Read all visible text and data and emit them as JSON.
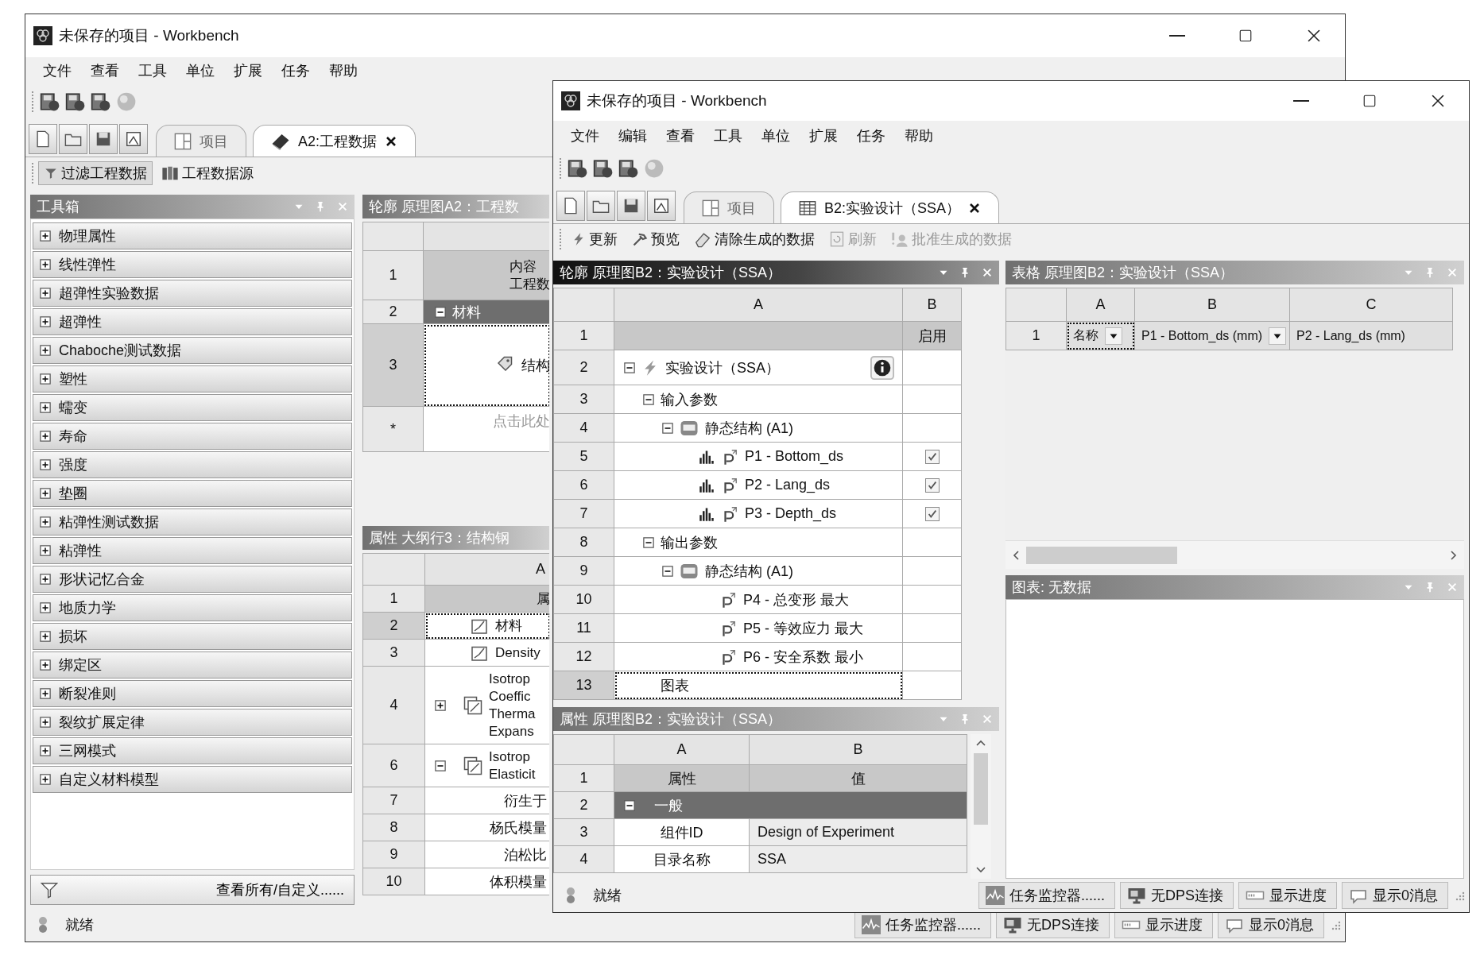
{
  "back_window": {
    "title": "未保存的项目 - Workbench",
    "menu": [
      "文件",
      "查看",
      "工具",
      "单位",
      "扩展",
      "任务",
      "帮助"
    ],
    "tabs": [
      {
        "label": "项目",
        "kind": "project",
        "selected": false,
        "closable": false
      },
      {
        "label": "A2:工程数据",
        "kind": "book",
        "selected": true,
        "closable": true
      }
    ],
    "filter_bar": [
      {
        "label": "过滤工程数据",
        "kind": "filter",
        "pressed": true
      },
      {
        "label": "工程数据源",
        "kind": "source",
        "pressed": false
      }
    ],
    "toolbox": {
      "title": "工具箱",
      "active": false,
      "items": [
        {
          "label": "物理属性",
          "expanded": false
        },
        {
          "label": "线性弹性",
          "expanded": false
        },
        {
          "label": "超弹性实验数据",
          "expanded": false
        },
        {
          "label": "超弹性",
          "expanded": false
        },
        {
          "label": "Chaboche测试数据",
          "expanded": false
        },
        {
          "label": "塑性",
          "expanded": false
        },
        {
          "label": "蠕变",
          "expanded": false
        },
        {
          "label": "寿命",
          "expanded": false
        },
        {
          "label": "强度",
          "expanded": false
        },
        {
          "label": "垫圈",
          "expanded": false
        },
        {
          "label": "粘弹性测试数据",
          "expanded": false
        },
        {
          "label": "粘弹性",
          "expanded": false
        },
        {
          "label": "形状记忆合金",
          "expanded": false
        },
        {
          "label": "地质力学",
          "expanded": false
        },
        {
          "label": "损坏",
          "expanded": false
        },
        {
          "label": "绑定区",
          "expanded": false
        },
        {
          "label": "断裂准则",
          "expanded": false
        },
        {
          "label": "裂纹扩展定律",
          "expanded": false
        },
        {
          "label": "三网模式",
          "expanded": false
        },
        {
          "label": "自定义材料模型",
          "expanded": false
        }
      ],
      "footer": "查看所有/自定义......"
    },
    "outline": {
      "title": "轮廓 原理图A2：工程数",
      "active": false,
      "rows": [
        {
          "number": "1",
          "kind": "header",
          "lines": [
            "内容",
            "工程数"
          ]
        },
        {
          "number": "2",
          "kind": "group",
          "text": "材料",
          "expanded": true
        },
        {
          "number": "3",
          "kind": "material",
          "text": "结构",
          "selected": true
        },
        {
          "number": "*",
          "kind": "new",
          "placeholder": "点击此处"
        }
      ]
    },
    "properties": {
      "title": "属性 大纲行3：结构钢",
      "active": false,
      "column": "A",
      "rows": [
        {
          "number": "1",
          "kind": "header",
          "lines": [
            "属"
          ],
          "selected": false
        },
        {
          "number": "2",
          "kind": "property",
          "lines": [
            "材料"
          ],
          "selected": true
        },
        {
          "number": "3",
          "kind": "property",
          "lines": [
            "Density"
          ],
          "selected": false
        },
        {
          "number": "4",
          "kind": "property_group",
          "lines": [
            "Isotrop",
            "Coeffic",
            "Therma",
            "Expans"
          ],
          "expanded": false,
          "selected": false
        },
        {
          "number": "6",
          "kind": "property_group",
          "lines": [
            "Isotrop",
            "Elasticit"
          ],
          "expanded": true,
          "selected": false
        },
        {
          "number": "7",
          "kind": "sub",
          "lines": [
            "衍生于"
          ],
          "selected": false
        },
        {
          "number": "8",
          "kind": "sub",
          "lines": [
            "杨氏模量"
          ],
          "selected": false
        },
        {
          "number": "9",
          "kind": "sub",
          "lines": [
            "泊松比"
          ],
          "selected": false
        },
        {
          "number": "10",
          "kind": "sub",
          "lines": [
            "体积模量"
          ],
          "selected": false
        }
      ]
    },
    "status": {
      "text": "就绪",
      "items": [
        {
          "kind": "monitor",
          "label": "任务监控器......"
        },
        {
          "kind": "dps",
          "label": "无DPS连接"
        },
        {
          "kind": "progress",
          "label": "显示进度"
        },
        {
          "kind": "messages",
          "label": "显示0消息"
        }
      ]
    }
  },
  "front_window": {
    "title": "未保存的项目 - Workbench",
    "menu": [
      "文件",
      "编辑",
      "查看",
      "工具",
      "单位",
      "扩展",
      "任务",
      "帮助"
    ],
    "tabs": [
      {
        "label": "项目",
        "kind": "project",
        "selected": false,
        "closable": false
      },
      {
        "label": "B2:实验设计（SSA）",
        "kind": "table",
        "selected": true,
        "closable": true
      }
    ],
    "toolbar": [
      {
        "label": "更新",
        "kind": "update",
        "disabled": false
      },
      {
        "label": "预览",
        "kind": "preview",
        "disabled": false
      },
      {
        "label": "清除生成的数据",
        "kind": "clear",
        "disabled": false
      },
      {
        "label": "刷新",
        "kind": "refresh",
        "disabled": true
      },
      {
        "label": "批准生成的数据",
        "kind": "approve",
        "disabled": true
      }
    ],
    "outline": {
      "title": "轮廓 原理图B2：实验设计（SSA）",
      "active": true,
      "columns": [
        "A",
        "B"
      ],
      "header": {
        "number": "1",
        "b": "启用"
      },
      "rows": [
        {
          "number": "2",
          "kind": "system",
          "text": "实验设计（SSA）",
          "expanded": true,
          "info": true,
          "selected": false,
          "children": [
            {
              "number": "3",
              "text": "输入参数",
              "expanded": true,
              "selected": false,
              "children": [
                {
                  "number": "4",
                  "kind": "component",
                  "text": "静态结构 (A1)",
                  "expanded": true,
                  "selected": false,
                  "children": [
                    {
                      "number": "5",
                      "kind": "input",
                      "text": "P1 - Bottom_ds",
                      "checked": true,
                      "selected": false
                    },
                    {
                      "number": "6",
                      "kind": "input",
                      "text": "P2 - Lang_ds",
                      "checked": true,
                      "selected": false
                    },
                    {
                      "number": "7",
                      "kind": "input",
                      "text": "P3 - Depth_ds",
                      "checked": true,
                      "selected": false
                    }
                  ]
                }
              ]
            },
            {
              "number": "8",
              "text": "输出参数",
              "expanded": true,
              "selected": false,
              "children": [
                {
                  "number": "9",
                  "kind": "component",
                  "text": "静态结构 (A1)",
                  "expanded": true,
                  "selected": false,
                  "children": [
                    {
                      "number": "10",
                      "kind": "output",
                      "text": "P4 - 总变形 最大",
                      "selected": false
                    },
                    {
                      "number": "11",
                      "kind": "output",
                      "text": "P5 - 等效应力 最大",
                      "selected": false
                    },
                    {
                      "number": "12",
                      "kind": "output",
                      "text": "P6 - 安全系数 最小",
                      "selected": false
                    }
                  ]
                }
              ]
            },
            {
              "number": "13",
              "text": "图表",
              "selected": true
            }
          ]
        }
      ]
    },
    "properties": {
      "title": "属性 原理图B2：实验设计（SSA）",
      "active": false,
      "columns": [
        "A",
        "B"
      ],
      "rows": [
        {
          "number": "1",
          "kind": "header",
          "a": "属性",
          "b": "值"
        },
        {
          "number": "2",
          "kind": "group",
          "a": "一般",
          "expanded": true
        },
        {
          "number": "3",
          "kind": "property",
          "a": "组件ID",
          "b": "Design of Experiment"
        },
        {
          "number": "4",
          "kind": "property",
          "a": "目录名称",
          "b": "SSA"
        }
      ]
    },
    "table": {
      "title": "表格 原理图B2：实验设计（SSA）",
      "active": false,
      "columns": [
        "A",
        "B",
        "C"
      ],
      "rows": [
        {
          "number": "1",
          "cells": [
            {
              "text": "名称",
              "dropdown": true,
              "selected": true
            },
            {
              "text": "P1 - Bottom_ds (mm)",
              "dropdown": true,
              "selected": false
            },
            {
              "text": "P2 - Lang_ds (mm)",
              "dropdown": false,
              "selected": false
            }
          ]
        }
      ]
    },
    "chart": {
      "title": "图表: 无数据",
      "active": false
    },
    "status": {
      "text": "就绪",
      "items": [
        {
          "kind": "monitor",
          "label": "任务监控器......"
        },
        {
          "kind": "dps",
          "label": "无DPS连接"
        },
        {
          "kind": "progress",
          "label": "显示进度"
        },
        {
          "kind": "messages",
          "label": "显示0消息"
        }
      ]
    }
  }
}
